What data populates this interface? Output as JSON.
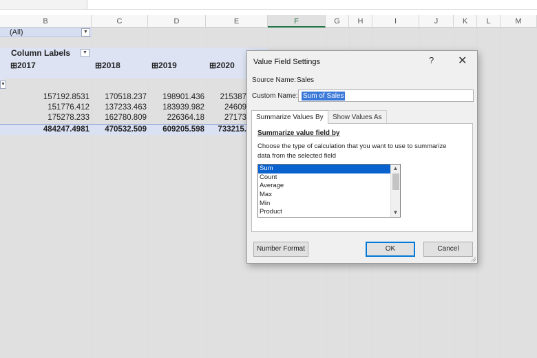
{
  "columns": [
    "B",
    "C",
    "D",
    "E",
    "F",
    "G",
    "H",
    "I",
    "J",
    "K",
    "L",
    "M"
  ],
  "selected_column": "F",
  "pivot": {
    "filter_value": "(All)",
    "column_labels": "Column Labels",
    "years": [
      "⊞2017",
      "⊞2018",
      "⊞2019",
      "⊞2020"
    ],
    "rows": [
      [
        "157192.8531",
        "170518.237",
        "198901.436",
        "215387"
      ],
      [
        "151776.412",
        "137233.463",
        "183939.982",
        "24609"
      ],
      [
        "175278.233",
        "162780.809",
        "226364.18",
        "27173"
      ]
    ],
    "totals": [
      "484247.4981",
      "470532.509",
      "609205.598",
      "733215."
    ]
  },
  "dialog": {
    "title": "Value Field Settings",
    "help": "?",
    "close": "✕",
    "source_label": "Source Name:",
    "source_value": "Sales",
    "custom_label": "Custom Name:",
    "custom_value": "Sum of Sales",
    "tabs": [
      "Summarize Values By",
      "Show Values As"
    ],
    "section_title": "Summarize value field by",
    "description_line1": "Choose the type of calculation that you want to use to summarize",
    "description_line2": "data from the selected field",
    "functions": [
      "Sum",
      "Count",
      "Average",
      "Max",
      "Min",
      "Product"
    ],
    "selected_function": "Sum",
    "number_format_button": "Number Format",
    "ok_button": "OK",
    "cancel_button": "Cancel"
  },
  "icons": {
    "dropdown": "chevron-down-icon",
    "expand": "plus-box-icon",
    "scroll_up": "chevron-up-icon",
    "scroll_down": "chevron-down-icon"
  }
}
